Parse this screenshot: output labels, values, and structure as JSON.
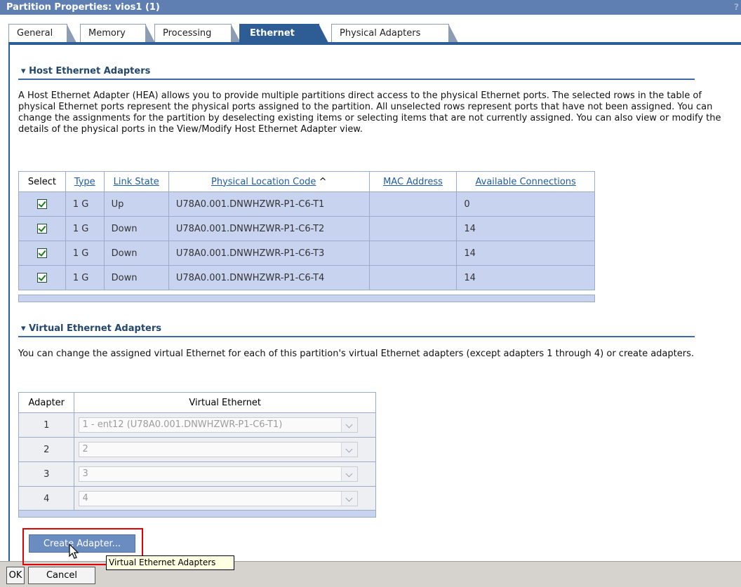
{
  "window": {
    "title": "Partition Properties: vios1 (1)",
    "help": "?"
  },
  "tabs": [
    {
      "label": "General"
    },
    {
      "label": "Memory"
    },
    {
      "label": "Processing"
    },
    {
      "label": "Ethernet",
      "active": true
    },
    {
      "label": "Physical Adapters"
    }
  ],
  "hea": {
    "heading": "Host Ethernet Adapters",
    "description": "A Host Ethernet Adapter (HEA) allows you to provide multiple partitions direct access to the physical Ethernet ports. The selected rows in the table of physical Ethernet ports represent the physical ports assigned to the partition. All unselected rows represent ports that have not been assigned. You can change the assignments for the partition by deselecting existing items or selecting items that are not currently assigned. You can also view or modify the details of the physical ports in the View/Modify Host Ethernet Adapter view.",
    "columns": {
      "select": "Select",
      "type": "Type",
      "link_state": "Link State",
      "location": "Physical Location Code",
      "sort_indicator": "^",
      "mac": "MAC Address",
      "available": "Available Connections"
    },
    "rows": [
      {
        "selected": true,
        "type": "1 G",
        "link_state": "Up",
        "location": "U78A0.001.DNWHZWR-P1-C6-T1",
        "mac": "",
        "available": "0"
      },
      {
        "selected": true,
        "type": "1 G",
        "link_state": "Down",
        "location": "U78A0.001.DNWHZWR-P1-C6-T2",
        "mac": "",
        "available": "14"
      },
      {
        "selected": true,
        "type": "1 G",
        "link_state": "Down",
        "location": "U78A0.001.DNWHZWR-P1-C6-T3",
        "mac": "",
        "available": "14"
      },
      {
        "selected": true,
        "type": "1 G",
        "link_state": "Down",
        "location": "U78A0.001.DNWHZWR-P1-C6-T4",
        "mac": "",
        "available": "14"
      }
    ]
  },
  "veth": {
    "heading": "Virtual Ethernet Adapters",
    "description": "You can change the assigned virtual Ethernet for each of this partition's virtual Ethernet adapters (except adapters 1 through 4) or create adapters.",
    "columns": {
      "adapter": "Adapter",
      "virtual": "Virtual Ethernet"
    },
    "rows": [
      {
        "adapter": "1",
        "virtual": "1 - ent12 (U78A0.001.DNWHZWR-P1-C6-T1)"
      },
      {
        "adapter": "2",
        "virtual": "2"
      },
      {
        "adapter": "3",
        "virtual": "3"
      },
      {
        "adapter": "4",
        "virtual": "4"
      }
    ],
    "create_button": "Create Adapter...",
    "tooltip": "Virtual Ethernet Adapters"
  },
  "footer": {
    "ok": "OK",
    "cancel": "Cancel"
  },
  "colors": {
    "title_bar": "#5f7fb3",
    "tab_active": "#2e5c95",
    "row_fill": "#c7d3ef",
    "highlight": "#e30000"
  }
}
